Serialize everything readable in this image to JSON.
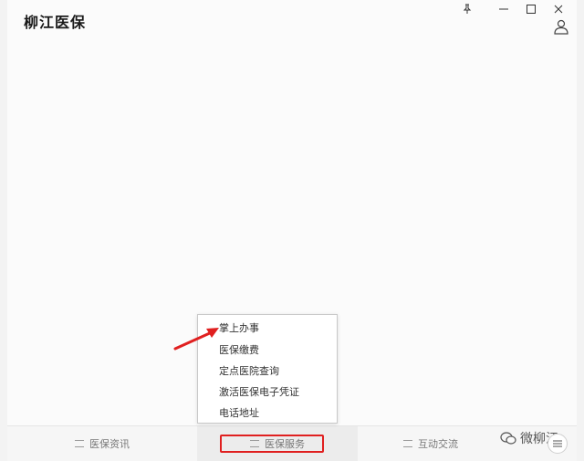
{
  "window": {
    "title": "柳江医保"
  },
  "popup_menu": {
    "items": [
      {
        "label": "掌上办事"
      },
      {
        "label": "医保缴费"
      },
      {
        "label": "定点医院查询"
      },
      {
        "label": "激活医保电子凭证"
      },
      {
        "label": "电话地址"
      }
    ]
  },
  "bottom_nav": {
    "tabs": [
      {
        "label": "医保资讯"
      },
      {
        "label": "医保服务"
      },
      {
        "label": "互动交流"
      }
    ],
    "active_tab": "医保服务"
  },
  "watermark": {
    "text": "微柳江"
  },
  "colors": {
    "highlight": "#e02020",
    "background": "#fbfbfb"
  },
  "icons": {
    "pin": "pin-icon",
    "minimize": "minimize-icon",
    "maximize": "maximize-icon",
    "close": "close-icon",
    "user": "user-icon"
  }
}
